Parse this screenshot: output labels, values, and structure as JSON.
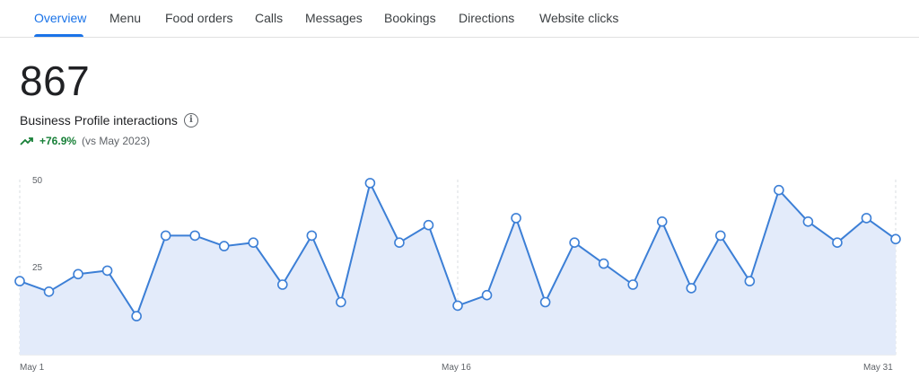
{
  "tabs": [
    {
      "label": "Overview",
      "active": true
    },
    {
      "label": "Menu"
    },
    {
      "label": "Food orders"
    },
    {
      "label": "Calls"
    },
    {
      "label": "Messages"
    },
    {
      "label": "Bookings"
    },
    {
      "label": "Directions"
    },
    {
      "label": "Website clicks"
    }
  ],
  "summary": {
    "value": "867",
    "label": "Business Profile interactions",
    "change": "+76.9%",
    "comparison": "(vs May 2023)",
    "change_color": "#188038"
  },
  "colors": {
    "accent": "#1a73e8",
    "area_fill": "#e3ebfa",
    "line": "#3c7fd6"
  },
  "icons": [
    "info-icon",
    "trending-up-icon"
  ],
  "chart_data": {
    "type": "area",
    "x": [
      "May 1",
      "May 2",
      "May 3",
      "May 4",
      "May 5",
      "May 6",
      "May 7",
      "May 8",
      "May 9",
      "May 10",
      "May 11",
      "May 12",
      "May 13",
      "May 14",
      "May 15",
      "May 16",
      "May 17",
      "May 18",
      "May 19",
      "May 20",
      "May 21",
      "May 22",
      "May 23",
      "May 24",
      "May 25",
      "May 26",
      "May 27",
      "May 28",
      "May 29",
      "May 30",
      "May 31"
    ],
    "values": [
      21,
      18,
      23,
      24,
      11,
      34,
      34,
      31,
      32,
      20,
      34,
      15,
      49,
      32,
      37,
      14,
      17,
      39,
      15,
      32,
      26,
      20,
      38,
      19,
      34,
      21,
      47,
      38,
      32,
      39,
      33
    ],
    "y_ticks": [
      "25",
      "50"
    ],
    "x_ticks": [
      "May 1",
      "May 16",
      "May 31"
    ],
    "ylim": [
      0,
      50
    ],
    "grid": "vertical-dashed-at-x-ticks",
    "markers": "hollow-circles"
  }
}
